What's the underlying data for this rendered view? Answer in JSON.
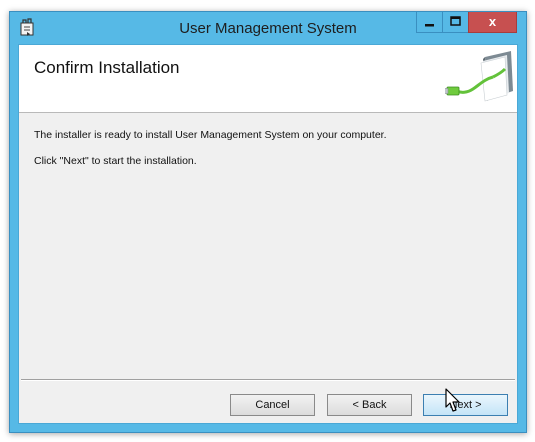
{
  "window": {
    "title": "User Management System",
    "close_label": "x"
  },
  "banner": {
    "title": "Confirm Installation"
  },
  "body": {
    "line1": "The installer is ready to install User Management System on your computer.",
    "line2": "Click \"Next\" to start the installation."
  },
  "buttons": {
    "cancel": "Cancel",
    "back": "< Back",
    "next": "Next >"
  },
  "colors": {
    "titlebar": "#56b9e6",
    "close": "#c75050",
    "client": "#f0f0f0",
    "banner": "#ffffff",
    "accent_green": "#63c23a"
  },
  "icons": {
    "app": "installer-icon",
    "banner_art": "usb-cable-book-icon",
    "minimize": "minimize-icon",
    "maximize": "maximize-icon",
    "close": "close-icon",
    "cursor": "mouse-pointer-icon"
  }
}
